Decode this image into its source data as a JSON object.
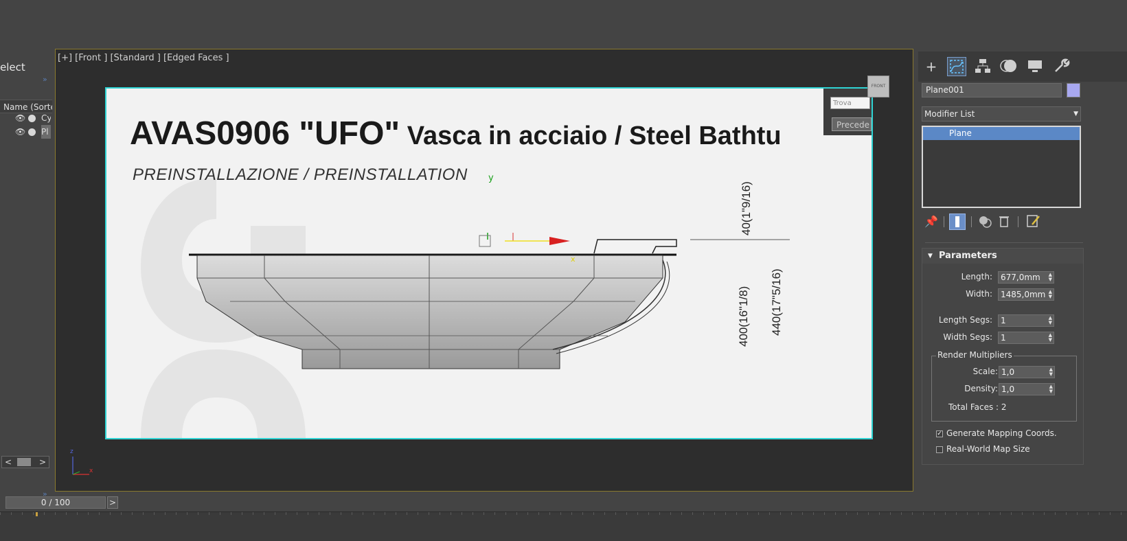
{
  "scene_explorer": {
    "title": "elect",
    "column_header": "Name (Sorte",
    "items": [
      {
        "name": "Cy"
      },
      {
        "name": "Pl"
      }
    ]
  },
  "viewport": {
    "label": "[+] [Front ] [Standard ] [Edged Faces ]",
    "viewcube_label": "FRONT",
    "reference_image": {
      "title_code": "AVAS0906 \"UFO\"",
      "title_rest": " Vasca in acciaio / Steel Bathtu",
      "subtitle": "PREINSTALLAZIONE / PREINSTALLATION",
      "dim_top": "40(1\"9/16)",
      "dim_mid": "400(16\"1/8)",
      "dim_right": "440(17\"5/16)",
      "popup_field": "Trova",
      "popup_button": "Precede"
    },
    "gizmo": {
      "y_label": "y",
      "x_label": "x"
    },
    "tripod": {
      "z": "z",
      "x": "x"
    }
  },
  "command_panel": {
    "object_name": "Plane001",
    "object_color": "#a8a8f0",
    "modifier_list": "Modifier List",
    "stack_item": "Plane",
    "parameters": {
      "header": "Parameters",
      "length_label": "Length:",
      "length": "677,0mm",
      "width_label": "Width:",
      "width": "1485,0mm",
      "length_segs_label": "Length Segs:",
      "length_segs": "1",
      "width_segs_label": "Width Segs:",
      "width_segs": "1",
      "render_group": "Render Multipliers",
      "scale_label": "Scale:",
      "scale": "1,0",
      "density_label": "Density:",
      "density": "1,0",
      "total_faces": "Total Faces : 2",
      "gen_mapping": "Generate Mapping Coords.",
      "gen_mapping_checked": true,
      "real_world": "Real-World Map Size",
      "real_world_checked": false
    }
  },
  "timeline": {
    "slider_value": "0 / 100",
    "next_label": ">"
  },
  "colors": {
    "selection_border": "#2fd4d4",
    "viewport_border": "#8a7a2e",
    "stack_highlight": "#5b88c6"
  }
}
